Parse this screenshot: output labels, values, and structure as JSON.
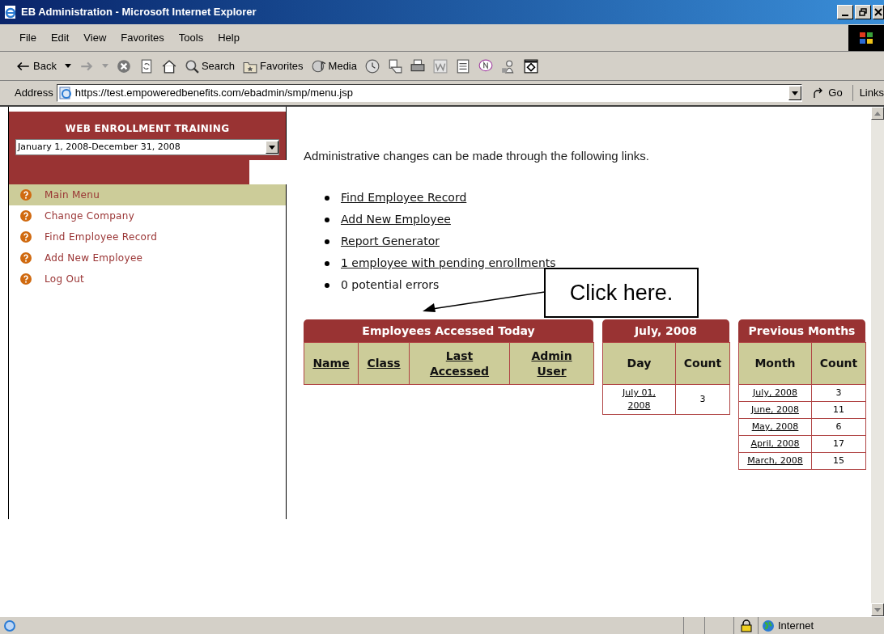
{
  "window": {
    "title": "EB Administration - Microsoft Internet Explorer"
  },
  "menu_bar": [
    "File",
    "Edit",
    "View",
    "Favorites",
    "Tools",
    "Help"
  ],
  "toolbar": [
    {
      "kind": "back",
      "label": "Back"
    },
    {
      "kind": "forward"
    },
    {
      "kind": "stop"
    },
    {
      "kind": "refresh"
    },
    {
      "kind": "home"
    },
    {
      "kind": "search",
      "label": "Search"
    },
    {
      "kind": "favorites",
      "label": "Favorites"
    },
    {
      "kind": "media",
      "label": "Media"
    },
    {
      "kind": "history"
    },
    {
      "kind": "mail"
    },
    {
      "kind": "print"
    },
    {
      "kind": "edit"
    },
    {
      "kind": "discuss"
    },
    {
      "kind": "messenger"
    },
    {
      "kind": "tool"
    },
    {
      "kind": "window"
    }
  ],
  "address_bar": {
    "label": "Address",
    "value": "https://test.empoweredbenefits.com/ebadmin/smp/menu.jsp",
    "go": "Go",
    "links": "Links"
  },
  "sidebar": {
    "title": "WEB ENROLLMENT TRAINING",
    "period": "January 1, 2008-December 31, 2008",
    "items": [
      {
        "label": "Main Menu",
        "selected": true
      },
      {
        "label": "Change Company",
        "selected": false
      },
      {
        "label": "Find Employee Record",
        "selected": false
      },
      {
        "label": "Add New Employee",
        "selected": false
      },
      {
        "label": "Log Out",
        "selected": false
      }
    ]
  },
  "main": {
    "intro": "Administrative changes can be made through the following links.",
    "links": [
      {
        "label": "Find Employee Record",
        "kind": "link"
      },
      {
        "label": "Add New Employee",
        "kind": "link"
      },
      {
        "label": "Report Generator",
        "kind": "link"
      },
      {
        "label": "1 employee with pending enrollments",
        "kind": "link"
      },
      {
        "label": "0 potential errors",
        "kind": "text"
      }
    ],
    "tables": [
      {
        "title": "Employees Accessed Today",
        "sortable": true,
        "columns": [
          "Name",
          "Class",
          "Last Accessed",
          "Admin User"
        ]
      },
      {
        "title": "July, 2008",
        "sortable": false,
        "columns": [
          "Day",
          "Count"
        ],
        "rows": [
          [
            "July 01, 2008",
            "3"
          ]
        ]
      },
      {
        "title": "Previous Months",
        "sortable": false,
        "columns": [
          "Month",
          "Count"
        ],
        "rows": [
          [
            "July, 2008",
            "3"
          ],
          [
            "June, 2008",
            "11"
          ],
          [
            "May, 2008",
            "6"
          ],
          [
            "April, 2008",
            "17"
          ],
          [
            "March, 2008",
            "15"
          ]
        ]
      }
    ]
  },
  "callout": {
    "text": "Click here."
  },
  "status_bar": {
    "zone": "Internet"
  }
}
